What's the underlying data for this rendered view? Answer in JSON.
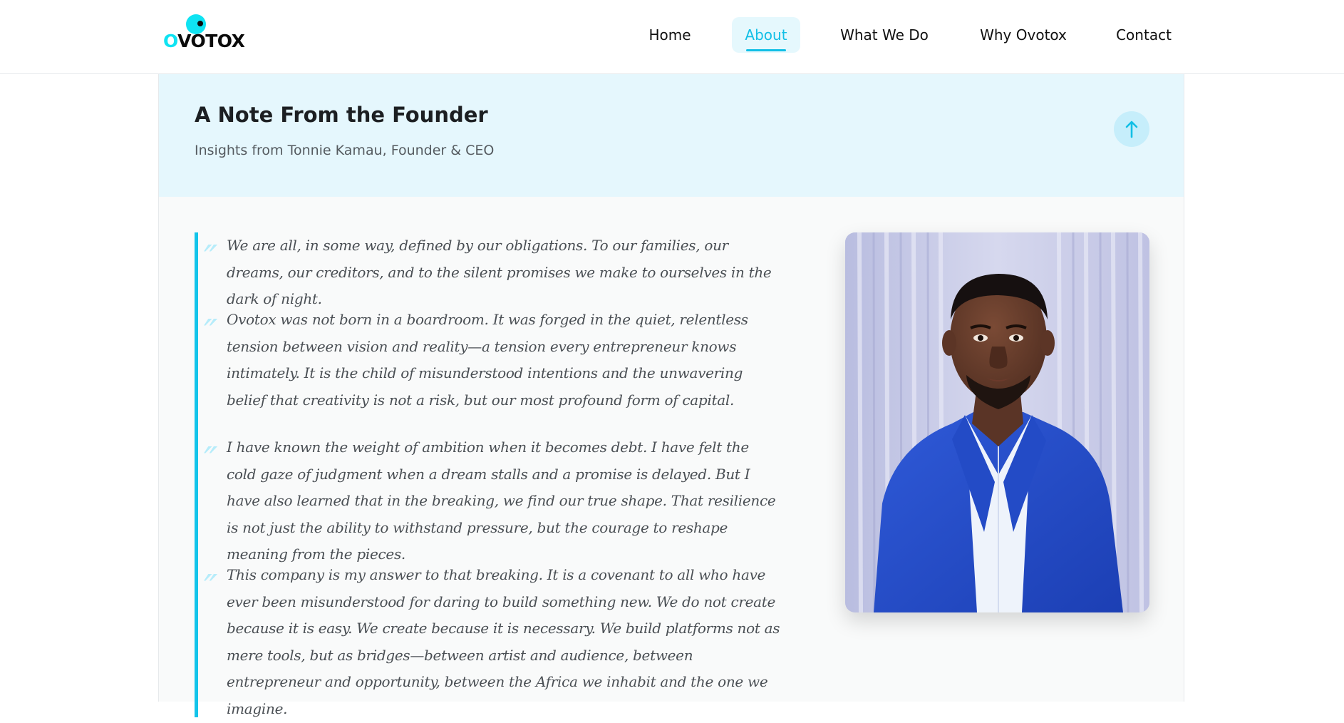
{
  "brand": {
    "logo_text": "VOTOX",
    "logo_accent": "O"
  },
  "nav": {
    "items": [
      {
        "label": "Home"
      },
      {
        "label": "About"
      },
      {
        "label": "What We Do"
      },
      {
        "label": "Why Ovotox"
      },
      {
        "label": "Contact"
      }
    ],
    "active": "About"
  },
  "founder": {
    "title": "A Note From the Founder",
    "subtitle": "Insights from Tonnie Kamau, Founder & CEO",
    "paragraphs": [
      "We are all, in some way, defined by our obligations. To our families, our dreams, our creditors, and to the silent promises we make to ourselves in the dark of night.",
      "Ovotox was not born in a boardroom. It was forged in the quiet, relentless tension between vision and reality—a tension every entrepreneur knows intimately. It is the child of misunderstood intentions and the unwavering belief that creativity is not a risk, but our most profound form of capital.",
      "I have known the weight of ambition when it becomes debt. I have felt the cold gaze of judgment when a dream stalls and a promise is delayed. But I have also learned that in the breaking, we find our true shape. That resilience is not just the ability to withstand pressure, but the courage to reshape meaning from the pieces.",
      "This company is my answer to that breaking. It is a covenant to all who have ever been misunderstood for daring to build something new. We do not create because it is easy. We create because it is necessary. We build platforms not as mere tools, but as bridges—between artist and audience, between entrepreneur and opportunity, between the Africa we inhabit and the one we imagine."
    ]
  },
  "icons": {
    "scroll_top": "arrow-up-icon",
    "quote": "quote-mark-icon"
  },
  "colors": {
    "accent": "#12bfe6",
    "header_band": "#e5f7fd",
    "quote_bar": "#13c4ea"
  }
}
